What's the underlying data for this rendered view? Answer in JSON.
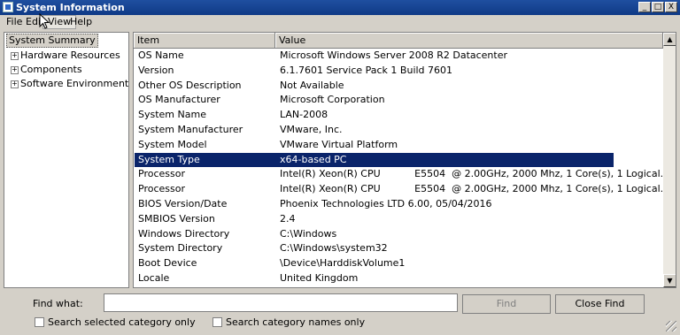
{
  "window": {
    "title": "System Information",
    "controls": {
      "minimize": "_",
      "maximize": "□",
      "close": "X"
    }
  },
  "menu": [
    "File",
    "Edit",
    "View",
    "Help"
  ],
  "tree": {
    "selected": "System Summary",
    "items": [
      "Hardware Resources",
      "Components",
      "Software Environment"
    ],
    "expander": "+"
  },
  "table": {
    "headers": {
      "item": "Item",
      "value": "Value"
    },
    "selected_index": 7,
    "rows": [
      {
        "item": "OS Name",
        "value": "Microsoft Windows Server 2008 R2 Datacenter"
      },
      {
        "item": "Version",
        "value": "6.1.7601 Service Pack 1 Build 7601"
      },
      {
        "item": "Other OS Description",
        "value": "Not Available"
      },
      {
        "item": "OS Manufacturer",
        "value": "Microsoft Corporation"
      },
      {
        "item": "System Name",
        "value": "LAN-2008"
      },
      {
        "item": "System Manufacturer",
        "value": "VMware, Inc."
      },
      {
        "item": "System Model",
        "value": "VMware Virtual Platform"
      },
      {
        "item": "System Type",
        "value": "x64-based PC"
      },
      {
        "item": "Processor",
        "value": "Intel(R) Xeon(R) CPU           E5504  @ 2.00GHz, 2000 Mhz, 1 Core(s), 1 Logical..."
      },
      {
        "item": "Processor",
        "value": "Intel(R) Xeon(R) CPU           E5504  @ 2.00GHz, 2000 Mhz, 1 Core(s), 1 Logical..."
      },
      {
        "item": "BIOS Version/Date",
        "value": "Phoenix Technologies LTD 6.00, 05/04/2016"
      },
      {
        "item": "SMBIOS Version",
        "value": "2.4"
      },
      {
        "item": "Windows Directory",
        "value": "C:\\Windows"
      },
      {
        "item": "System Directory",
        "value": "C:\\Windows\\system32"
      },
      {
        "item": "Boot Device",
        "value": "\\Device\\HarddiskVolume1"
      },
      {
        "item": "Locale",
        "value": "United Kingdom"
      }
    ]
  },
  "scrollbar": {
    "up": "▲",
    "down": "▼"
  },
  "find": {
    "label": "Find what:",
    "value": "",
    "find_button": "Find",
    "close_button": "Close Find",
    "option_selected_category": "Search selected category only",
    "option_category_names": "Search category names only"
  },
  "colors": {
    "titlebar": "#0f3a86",
    "selection": "#0a246a",
    "chrome": "#d4d0c8"
  }
}
